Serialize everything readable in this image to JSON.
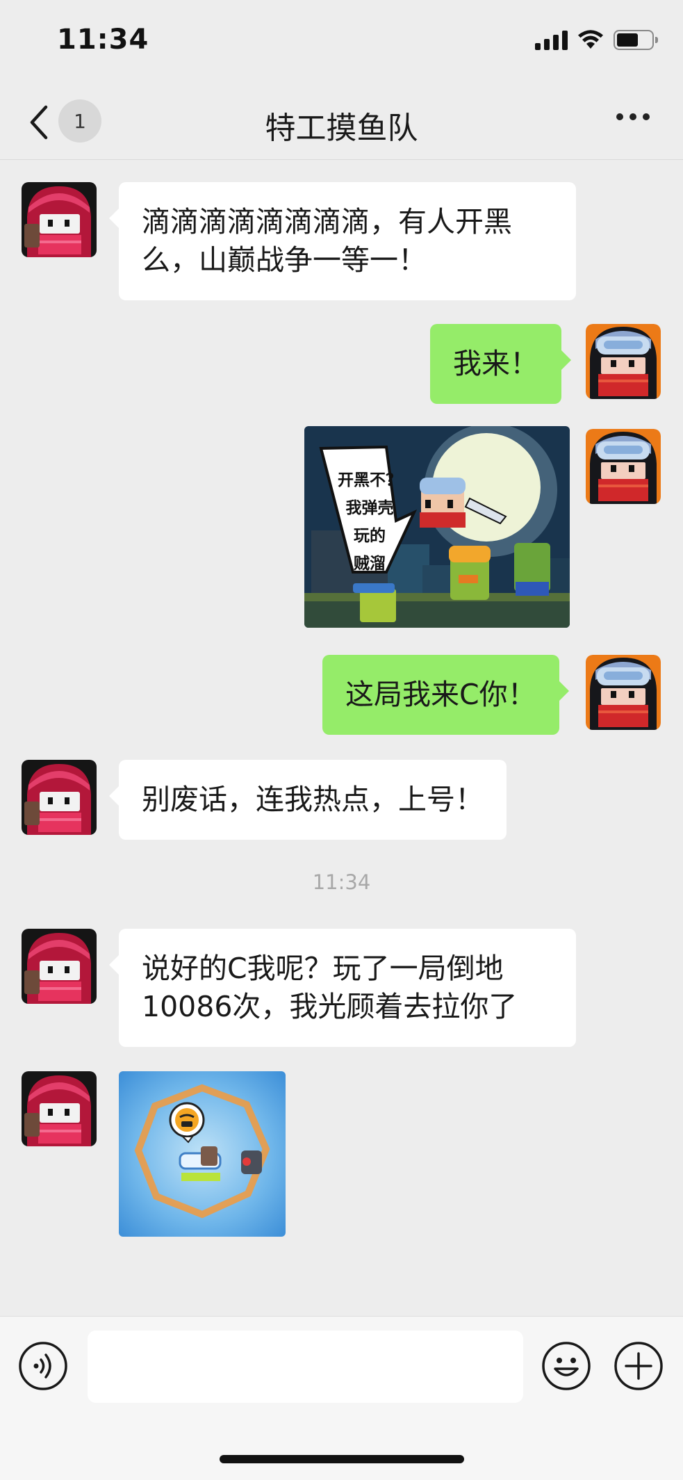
{
  "status_bar": {
    "time": "11:34"
  },
  "nav": {
    "badge": "1",
    "title": "特工摸鱼队"
  },
  "messages": [
    {
      "side": "left",
      "text": "滴滴滴滴滴滴滴滴，有人开黑么，山巅战争一等一！"
    },
    {
      "side": "right",
      "text": "我来！"
    },
    {
      "side": "right",
      "image": "comic",
      "image_text": [
        "开黑不？",
        "我弹壳",
        "玩的",
        "贼溜"
      ]
    },
    {
      "side": "right",
      "text": "这局我来C你！"
    },
    {
      "side": "left",
      "text": "别废话，连我热点，上号！"
    },
    {
      "side": "left",
      "text": "说好的C我呢？玩了一局倒地10086次，我光顾着去拉你了"
    },
    {
      "side": "left",
      "image": "game-screenshot"
    }
  ],
  "timestamp": "11:34",
  "bottom_bar": {
    "icons": [
      "voice-icon",
      "emoji-icon",
      "plus-icon"
    ],
    "input_value": ""
  },
  "colors": {
    "background": "#ededed",
    "my_bubble": "#95ec69",
    "their_bubble": "#ffffff"
  }
}
